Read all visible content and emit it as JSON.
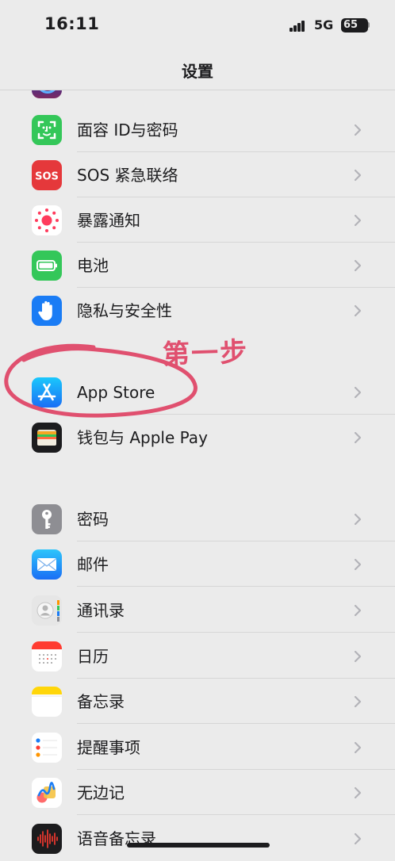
{
  "status_bar": {
    "time": "16:11",
    "network": "5G",
    "battery": "65",
    "signal_bars": 4
  },
  "nav": {
    "title": "设置"
  },
  "annotation": {
    "step_text": "第一步",
    "color": "#e0506f"
  },
  "group1": {
    "items": [
      {
        "label": "面容 ID与密码",
        "icon": "face-id-icon",
        "color": "#34c759"
      },
      {
        "label": "SOS 紧急联络",
        "icon": "sos-icon",
        "color": "#e5383b"
      },
      {
        "label": "暴露通知",
        "icon": "exposure-notification-icon",
        "color": "#ff3b5c"
      },
      {
        "label": "电池",
        "icon": "battery-icon",
        "color": "#34c759"
      },
      {
        "label": "隐私与安全性",
        "icon": "hand-icon",
        "color": "#1a7cf5"
      }
    ]
  },
  "group2": {
    "items": [
      {
        "label": "App Store",
        "icon": "app-store-icon",
        "color": "#1e9bfa"
      },
      {
        "label": "钱包与 Apple Pay",
        "icon": "wallet-icon",
        "color": "#1c1c1e"
      }
    ]
  },
  "group3": {
    "items": [
      {
        "label": "密码",
        "icon": "key-icon",
        "color": "#8e8e93"
      },
      {
        "label": "邮件",
        "icon": "mail-icon",
        "color": "#1e9bfa"
      },
      {
        "label": "通讯录",
        "icon": "contacts-icon",
        "color": "#d9d9d9"
      },
      {
        "label": "日历",
        "icon": "calendar-icon",
        "color": "#ff3b30"
      },
      {
        "label": "备忘录",
        "icon": "notes-icon",
        "color": "#ffd60a"
      },
      {
        "label": "提醒事项",
        "icon": "reminders-icon",
        "color": "#ffffff"
      },
      {
        "label": "无边记",
        "icon": "freeform-icon",
        "color": "#ffffff"
      },
      {
        "label": "语音备忘录",
        "icon": "voice-memos-icon",
        "color": "#1c1c1e"
      }
    ]
  }
}
